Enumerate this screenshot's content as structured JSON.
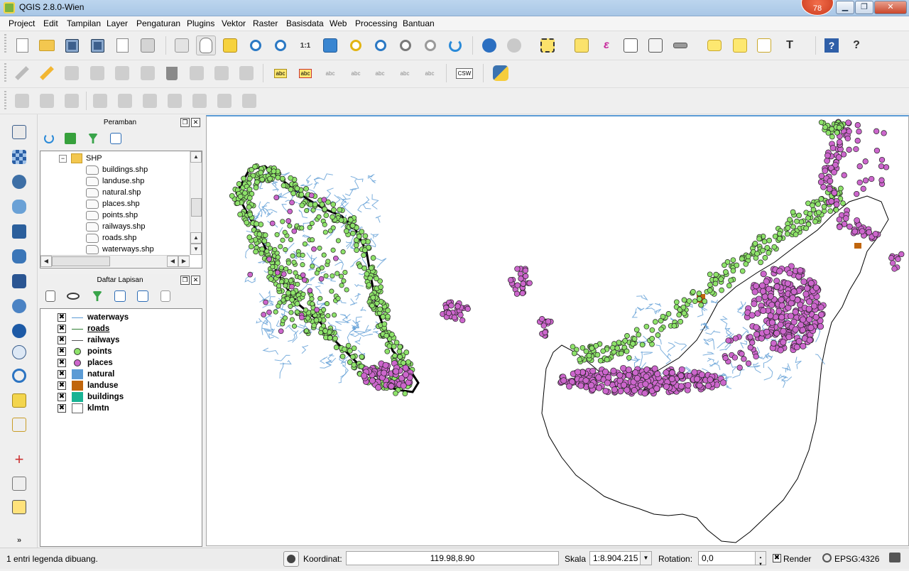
{
  "window": {
    "title": "QGIS 2.8.0-Wien",
    "badge_count": "78",
    "controls": {
      "minimize": "▁",
      "maximize": "❐",
      "close": "✕"
    }
  },
  "menubar": {
    "items": [
      "Project",
      "Edit",
      "Tampilan",
      "Layer",
      "Pengaturan",
      "Plugins",
      "Vektor",
      "Raster",
      "Basisdata",
      "Web",
      "Processing",
      "Bantuan"
    ]
  },
  "toolbar": {
    "csw_label": "CSW",
    "abc_label": "abc",
    "zoom_11_label": "1:1",
    "text_tool_label": "T",
    "help_label": "?",
    "whats_this_label": "?"
  },
  "browser_panel": {
    "title": "Peramban",
    "folder": "SHP",
    "files": [
      "buildings.shp",
      "landuse.shp",
      "natural.shp",
      "places.shp",
      "points.shp",
      "railways.shp",
      "roads.shp",
      "waterways.shp"
    ]
  },
  "layers_panel": {
    "title": "Daftar Lapisan",
    "layers": [
      {
        "name": "waterways",
        "checked": true,
        "symbol": "line",
        "color": "#5b9bd5"
      },
      {
        "name": "roads",
        "checked": true,
        "symbol": "line",
        "color": "#2e7d32",
        "underline": true
      },
      {
        "name": "railways",
        "checked": true,
        "symbol": "line",
        "color": "#555555"
      },
      {
        "name": "points",
        "checked": true,
        "symbol": "point",
        "color": "#8ee36a"
      },
      {
        "name": "places",
        "checked": true,
        "symbol": "point",
        "color": "#cc66cc"
      },
      {
        "name": "natural",
        "checked": true,
        "symbol": "fill",
        "color": "#5b9bd5"
      },
      {
        "name": "landuse",
        "checked": true,
        "symbol": "fill",
        "color": "#c0650c"
      },
      {
        "name": "buildings",
        "checked": true,
        "symbol": "fill",
        "color": "#19b394"
      },
      {
        "name": "klmtn",
        "checked": true,
        "symbol": "fill",
        "color": "#ffffff"
      }
    ],
    "check_glyph": "✖"
  },
  "statusbar": {
    "message": "1 entri legenda dibuang.",
    "coord_label": "Koordinat:",
    "coord_value": "119.98,8.90",
    "scale_label": "Skala",
    "scale_value": "1:8.904.215",
    "rotation_label": "Rotation:",
    "rotation_value": "0,0",
    "render_label": "Render",
    "crs_label": "EPSG:4326"
  },
  "colors": {
    "points": "#8ee36a",
    "places": "#cc66cc",
    "waterways": "#5b9bd5",
    "landuse": "#c0650c",
    "outline": "#000000"
  }
}
